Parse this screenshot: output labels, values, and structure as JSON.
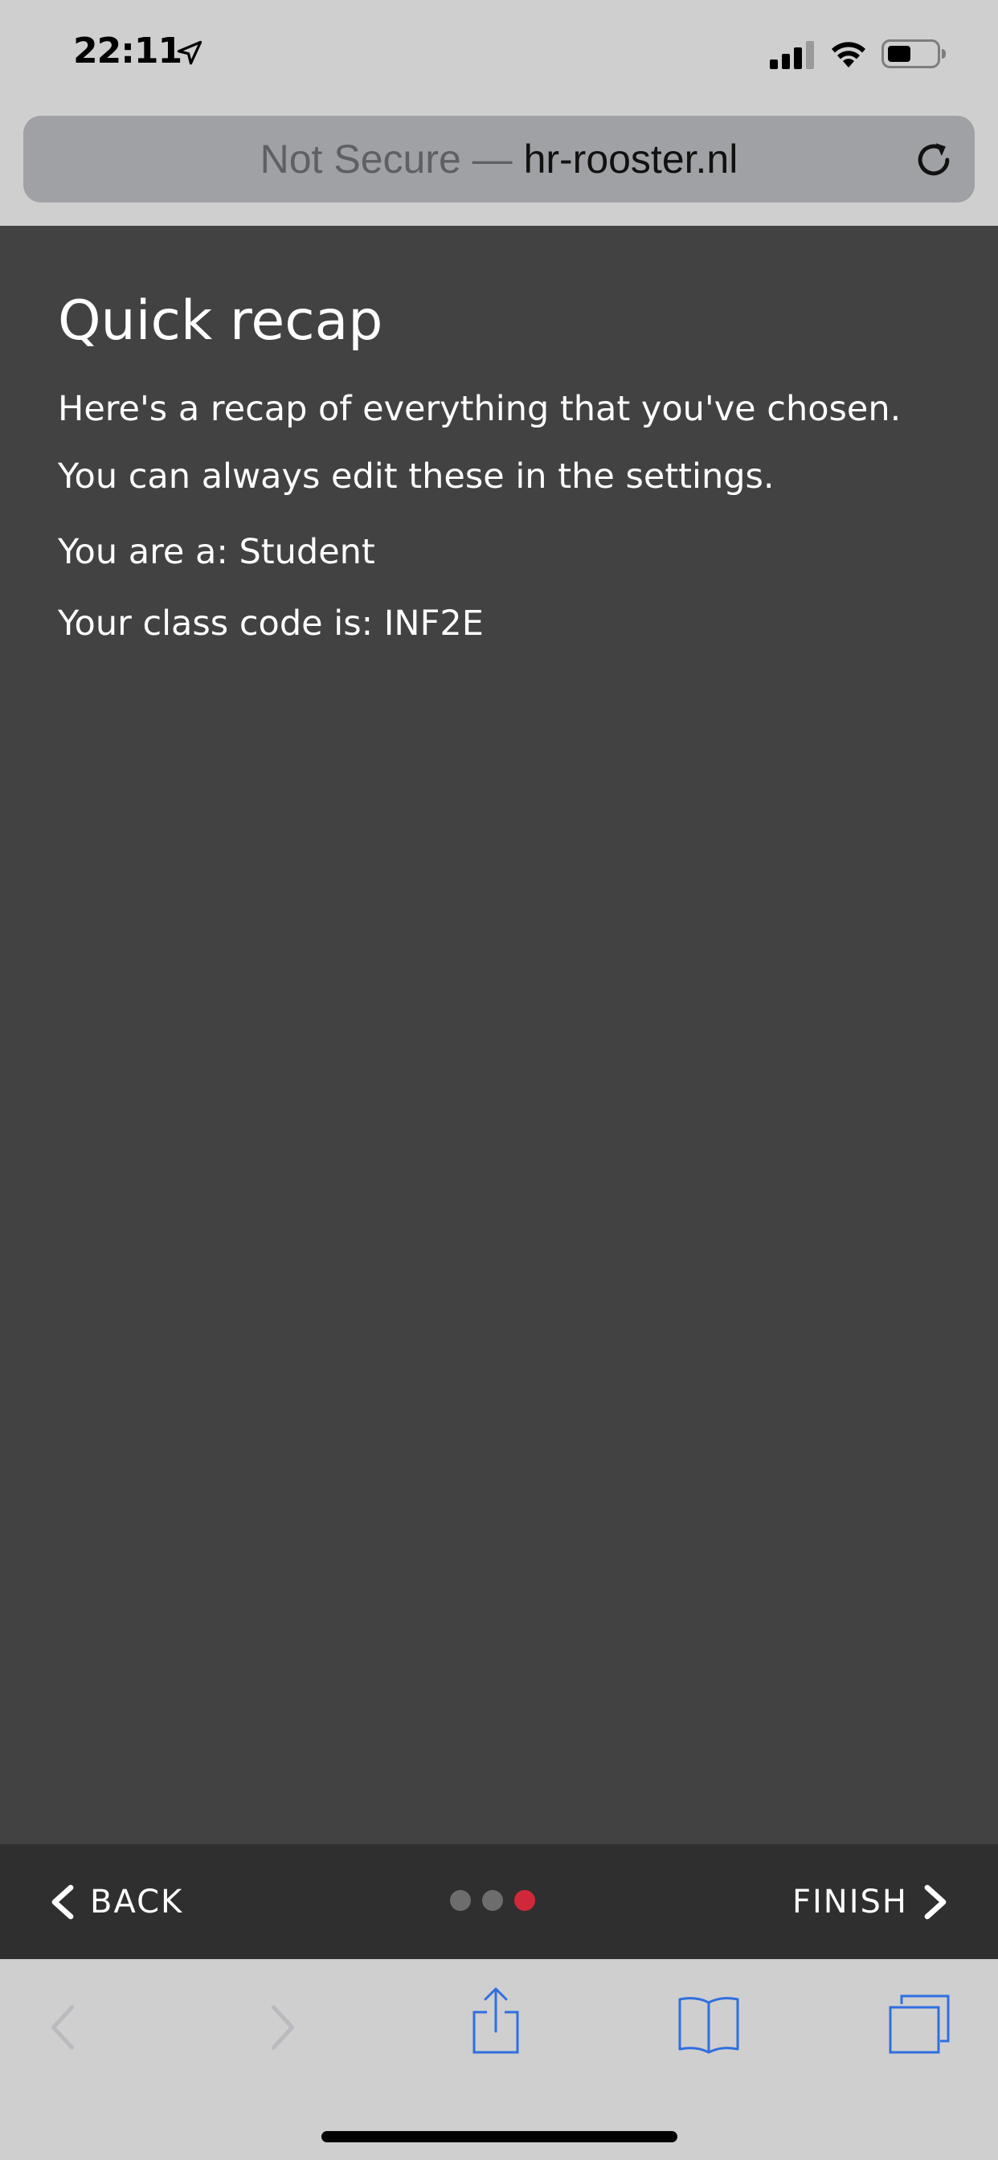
{
  "status_bar": {
    "time": "22:11",
    "icons": [
      "location-arrow-icon",
      "cellular-signal-icon",
      "wifi-icon",
      "battery-icon"
    ]
  },
  "address_bar": {
    "security_label": "Not Secure —",
    "domain": "hr-rooster.nl"
  },
  "page": {
    "title": "Quick recap",
    "intro": "Here's a recap of everything that you've chosen.",
    "note": "You can always edit these in the settings.",
    "role_line": "You are a: Student",
    "class_line": "Your class code is: INF2E"
  },
  "wizard": {
    "back_label": "BACK",
    "finish_label": "FINISH",
    "steps_total": 3,
    "current_step": 3,
    "active_color": "#d0283a",
    "inactive_color": "#6d6d6d"
  },
  "toolbar": {
    "icons": [
      "back-arrow-icon",
      "forward-arrow-icon",
      "share-icon",
      "bookmarks-icon",
      "tabs-icon"
    ],
    "accent_color": "#2f6fe0"
  }
}
